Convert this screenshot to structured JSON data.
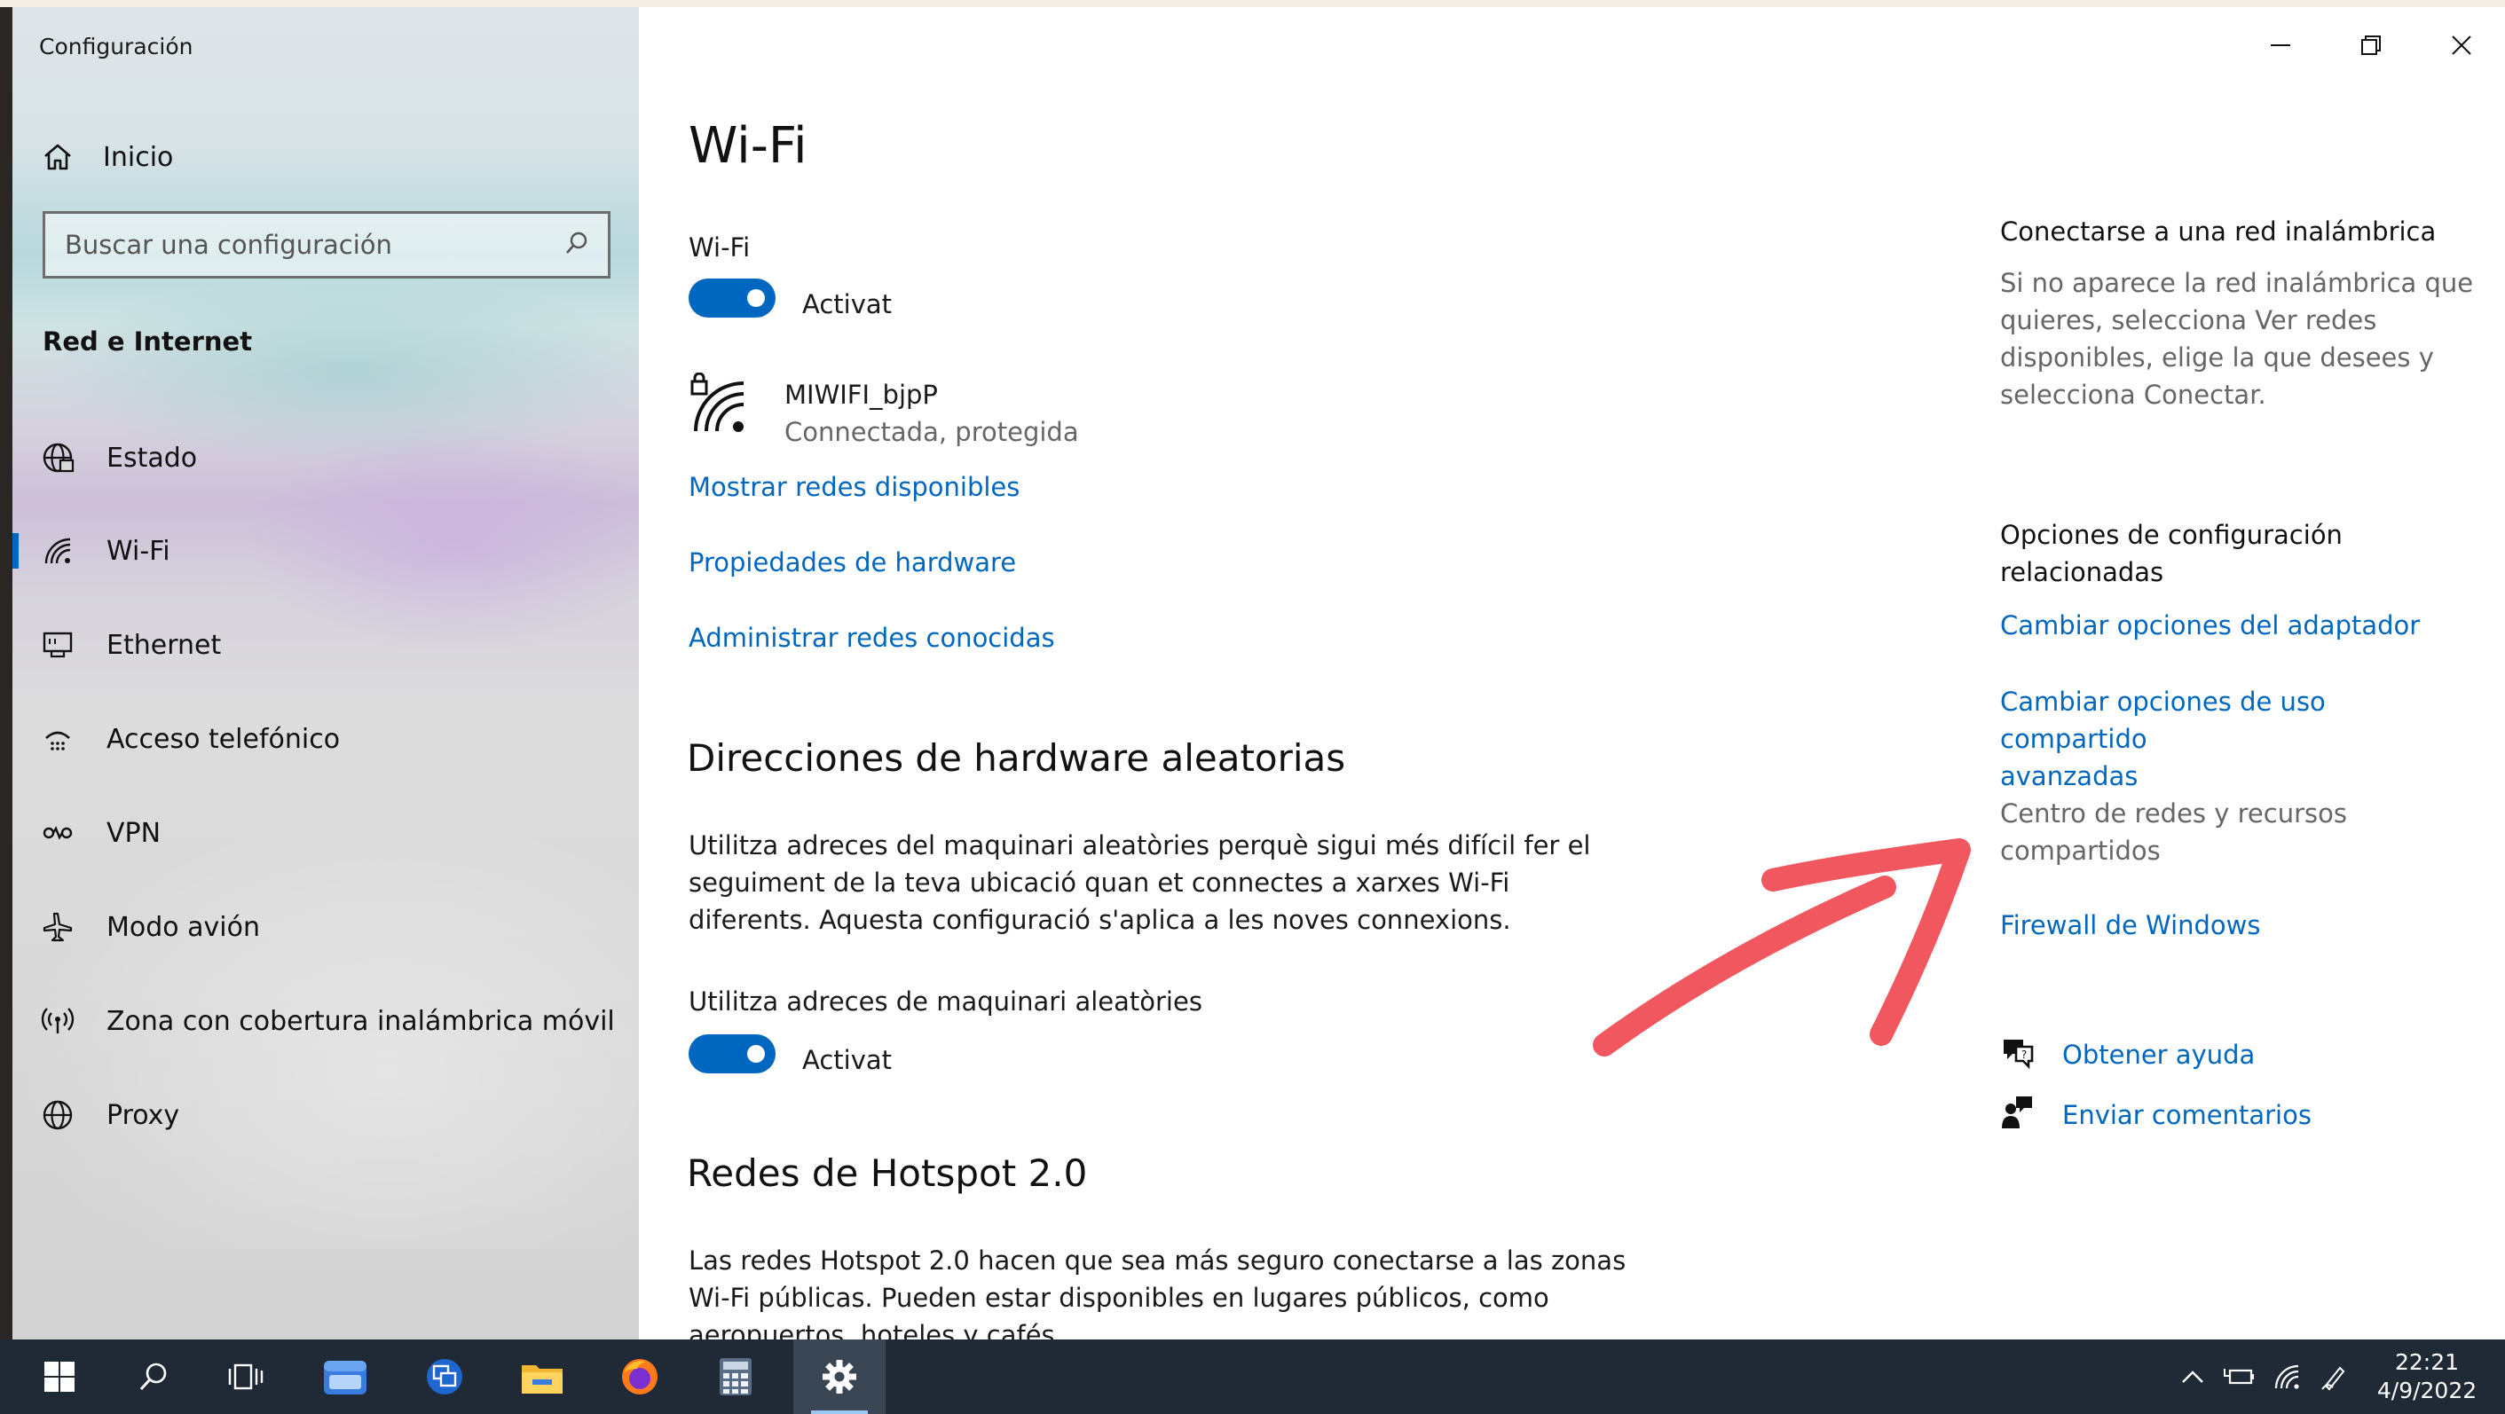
{
  "window": {
    "title": "Configuración"
  },
  "sidebar": {
    "home_label": "Inicio",
    "search_placeholder": "Buscar una configuración",
    "section_label": "Red e Internet",
    "items": [
      {
        "label": "Estado",
        "icon": "globe-status-icon"
      },
      {
        "label": "Wi-Fi",
        "icon": "wifi-icon",
        "active": true
      },
      {
        "label": "Ethernet",
        "icon": "ethernet-icon"
      },
      {
        "label": "Acceso telefónico",
        "icon": "dialup-icon"
      },
      {
        "label": "VPN",
        "icon": "vpn-icon"
      },
      {
        "label": "Modo avión",
        "icon": "airplane-icon"
      },
      {
        "label": "Zona con cobertura inalámbrica móvil",
        "icon": "hotspot-icon"
      },
      {
        "label": "Proxy",
        "icon": "globe-icon"
      }
    ]
  },
  "main": {
    "title": "Wi-Fi",
    "wifi_label": "Wi-Fi",
    "wifi_toggle": "Activat",
    "network": {
      "name": "MIWIFI_bjpP",
      "status": "Connectada, protegida"
    },
    "links": [
      "Mostrar redes disponibles",
      "Propiedades de hardware",
      "Administrar redes conocidas"
    ],
    "random_hw": {
      "heading": "Direcciones de hardware aleatorias",
      "paragraph_lines": [
        "Utilitza adreces del maquinari aleatòries perquè sigui més difícil fer el",
        "seguiment de la teva ubicació quan et connectes a xarxes Wi-Fi",
        "diferents. Aquesta configuració s'aplica a les noves connexions."
      ],
      "toggle_label": "Utilitza adreces de maquinari aleatòries",
      "toggle_state": "Activat"
    },
    "hotspot": {
      "heading": "Redes de Hotspot 2.0",
      "paragraph_lines": [
        "Las redes Hotspot 2.0 hacen que sea más seguro conectarse a las zonas",
        "Wi-Fi públicas. Pueden estar disponibles en lugares públicos, como",
        "aeropuertos, hoteles y cafés."
      ]
    }
  },
  "right": {
    "connect_heading": "Conectarse a una red inalámbrica",
    "connect_lines": [
      "Si no aparece la red inalámbrica que",
      "quieres, selecciona Ver redes",
      "disponibles, elige la que desees y",
      "selecciona Conectar."
    ],
    "related_heading_lines": [
      "Opciones de configuración",
      "relacionadas"
    ],
    "related_links": {
      "adapter": "Cambiar opciones del adaptador",
      "sharing_lines": [
        "Cambiar opciones de uso compartido",
        "avanzadas"
      ],
      "network_center_lines": [
        "Centro de redes y recursos",
        "compartidos"
      ],
      "firewall": "Firewall de Windows"
    },
    "help": "Obtener ayuda",
    "feedback": "Enviar comentarios"
  },
  "taskbar": {
    "time": "22:21",
    "date": "4/9/2022"
  },
  "colors": {
    "accent": "#0067c0",
    "annotation_arrow": "#f0575e",
    "taskbar": "#1f2a36"
  }
}
